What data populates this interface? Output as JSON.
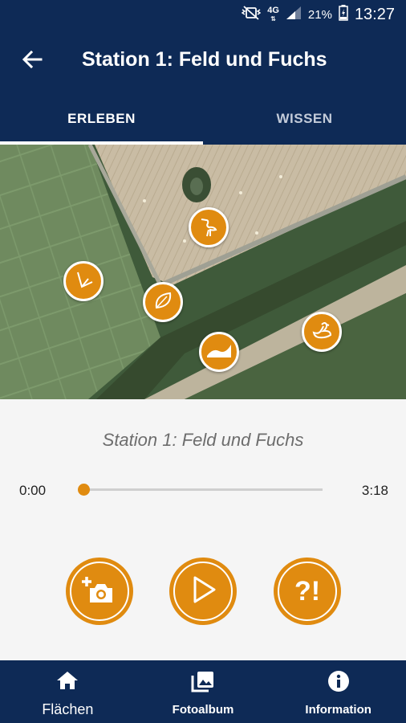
{
  "status_bar": {
    "network": "4G",
    "battery": "21%",
    "time": "13:27",
    "icons": [
      "vibrate-mute-icon",
      "network-4g-icon",
      "signal-icon",
      "battery-icon"
    ]
  },
  "app_bar": {
    "title": "Station 1: Feld und Fuchs",
    "back_icon": "arrow-left-icon"
  },
  "tabs": [
    {
      "label": "ERLEBEN",
      "selected": true
    },
    {
      "label": "WISSEN",
      "selected": false
    }
  ],
  "map": {
    "markers": [
      {
        "name": "heron",
        "icon": "heron-icon"
      },
      {
        "name": "grass",
        "icon": "grass-icon"
      },
      {
        "name": "leaf",
        "icon": "leaf-icon"
      },
      {
        "name": "wave",
        "icon": "wave-icon"
      },
      {
        "name": "swan",
        "icon": "swan-icon"
      }
    ]
  },
  "player": {
    "station_name": "Station 1: Feld und Fuchs",
    "current_time": "0:00",
    "total_time": "3:18",
    "progress": 0,
    "buttons": [
      {
        "name": "add-photo",
        "icon": "add-photo-icon"
      },
      {
        "name": "play",
        "icon": "play-icon"
      },
      {
        "name": "quiz",
        "label": "?!"
      }
    ]
  },
  "bottom_nav": [
    {
      "label": "Flächen",
      "icon": "home-icon"
    },
    {
      "label": "Fotoalbum",
      "icon": "photo-album-icon"
    },
    {
      "label": "Information",
      "icon": "info-icon"
    }
  ],
  "colors": {
    "primary": "#0e2a56",
    "accent": "#e08b10",
    "background": "#f5f5f5"
  }
}
